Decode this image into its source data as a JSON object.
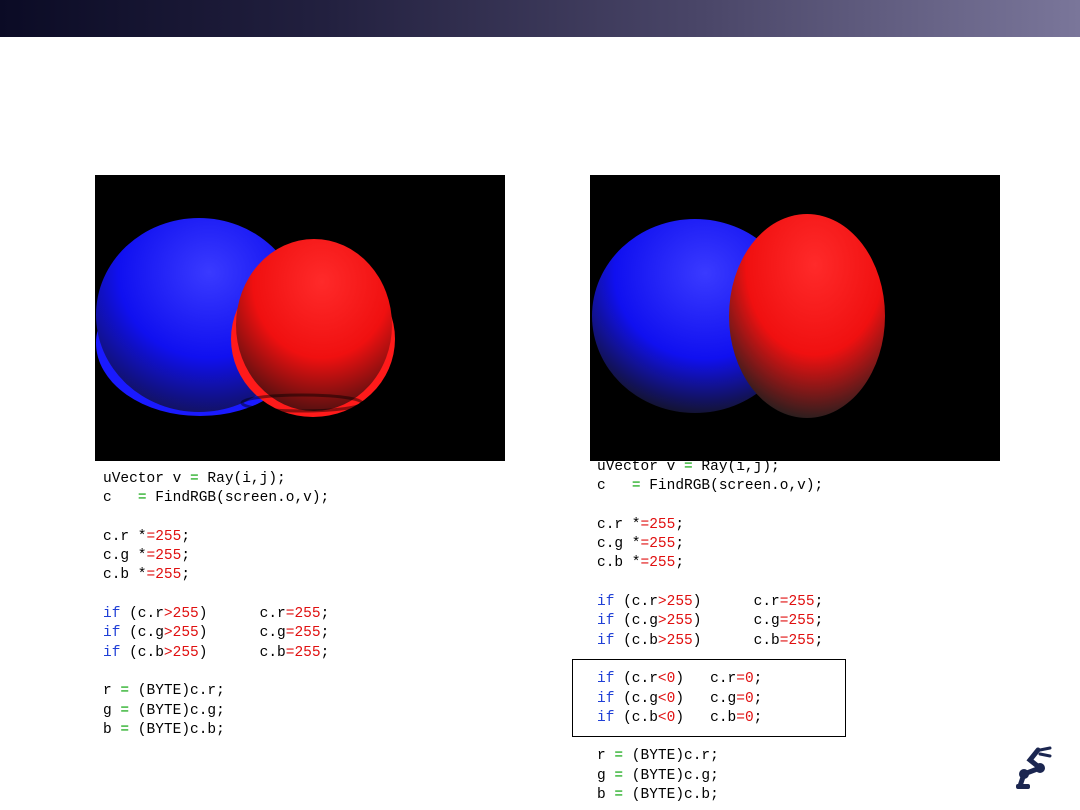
{
  "colors": {
    "keyword": "#1f3fd6",
    "number": "#e01010",
    "operator_assign": "#00a000",
    "sphere_blue": "#1c1cff",
    "sphere_red": "#ff1c1c"
  },
  "left_code": [
    [
      {
        "t": "uVector v "
      },
      {
        "t": "=",
        "c": "op-g"
      },
      {
        "t": " Ray(i,j);"
      }
    ],
    [
      {
        "t": "c   "
      },
      {
        "t": "=",
        "c": "op-g"
      },
      {
        "t": " FindRGB(screen.o,v);"
      }
    ],
    [],
    [
      {
        "t": "c.r *"
      },
      {
        "t": "=255",
        "c": "op-r"
      },
      {
        "t": ";"
      }
    ],
    [
      {
        "t": "c.g *"
      },
      {
        "t": "=255",
        "c": "op-r"
      },
      {
        "t": ";"
      }
    ],
    [
      {
        "t": "c.b *"
      },
      {
        "t": "=255",
        "c": "op-r"
      },
      {
        "t": ";"
      }
    ],
    [],
    [
      {
        "t": "if",
        "c": "kw"
      },
      {
        "t": " (c.r"
      },
      {
        "t": ">255",
        "c": "op-r"
      },
      {
        "t": ")      c.r"
      },
      {
        "t": "=255",
        "c": "op-r"
      },
      {
        "t": ";"
      }
    ],
    [
      {
        "t": "if",
        "c": "kw"
      },
      {
        "t": " (c.g"
      },
      {
        "t": ">255",
        "c": "op-r"
      },
      {
        "t": ")      c.g"
      },
      {
        "t": "=255",
        "c": "op-r"
      },
      {
        "t": ";"
      }
    ],
    [
      {
        "t": "if",
        "c": "kw"
      },
      {
        "t": " (c.b"
      },
      {
        "t": ">255",
        "c": "op-r"
      },
      {
        "t": ")      c.b"
      },
      {
        "t": "=255",
        "c": "op-r"
      },
      {
        "t": ";"
      }
    ],
    [],
    [
      {
        "t": "r "
      },
      {
        "t": "=",
        "c": "op-g"
      },
      {
        "t": " (BYTE)c.r;"
      }
    ],
    [
      {
        "t": "g "
      },
      {
        "t": "=",
        "c": "op-g"
      },
      {
        "t": " (BYTE)c.g;"
      }
    ],
    [
      {
        "t": "b "
      },
      {
        "t": "=",
        "c": "op-g"
      },
      {
        "t": " (BYTE)c.b;"
      }
    ]
  ],
  "right_code": [
    [
      {
        "t": "uVector v "
      },
      {
        "t": "=",
        "c": "op-g"
      },
      {
        "t": " Ray(i,j);"
      }
    ],
    [
      {
        "t": "c   "
      },
      {
        "t": "=",
        "c": "op-g"
      },
      {
        "t": " FindRGB(screen.o,v);"
      }
    ],
    [],
    [
      {
        "t": "c.r *"
      },
      {
        "t": "=255",
        "c": "op-r"
      },
      {
        "t": ";"
      }
    ],
    [
      {
        "t": "c.g *"
      },
      {
        "t": "=255",
        "c": "op-r"
      },
      {
        "t": ";"
      }
    ],
    [
      {
        "t": "c.b *"
      },
      {
        "t": "=255",
        "c": "op-r"
      },
      {
        "t": ";"
      }
    ],
    [],
    [
      {
        "t": "if",
        "c": "kw"
      },
      {
        "t": " (c.r"
      },
      {
        "t": ">255",
        "c": "op-r"
      },
      {
        "t": ")      c.r"
      },
      {
        "t": "=255",
        "c": "op-r"
      },
      {
        "t": ";"
      }
    ],
    [
      {
        "t": "if",
        "c": "kw"
      },
      {
        "t": " (c.g"
      },
      {
        "t": ">255",
        "c": "op-r"
      },
      {
        "t": ")      c.g"
      },
      {
        "t": "=255",
        "c": "op-r"
      },
      {
        "t": ";"
      }
    ],
    [
      {
        "t": "if",
        "c": "kw"
      },
      {
        "t": " (c.b"
      },
      {
        "t": ">255",
        "c": "op-r"
      },
      {
        "t": ")      c.b"
      },
      {
        "t": "=255",
        "c": "op-r"
      },
      {
        "t": ";"
      }
    ],
    [],
    [
      {
        "t": "if",
        "c": "kw"
      },
      {
        "t": " (c.r"
      },
      {
        "t": "<0",
        "c": "op-r"
      },
      {
        "t": ")   c.r"
      },
      {
        "t": "=0",
        "c": "op-r"
      },
      {
        "t": ";"
      }
    ],
    [
      {
        "t": "if",
        "c": "kw"
      },
      {
        "t": " (c.g"
      },
      {
        "t": "<0",
        "c": "op-r"
      },
      {
        "t": ")   c.g"
      },
      {
        "t": "=0",
        "c": "op-r"
      },
      {
        "t": ";"
      }
    ],
    [
      {
        "t": "if",
        "c": "kw"
      },
      {
        "t": " (c.b"
      },
      {
        "t": "<0",
        "c": "op-r"
      },
      {
        "t": ")   c.b"
      },
      {
        "t": "=0",
        "c": "op-r"
      },
      {
        "t": ";"
      }
    ],
    [],
    [
      {
        "t": "r "
      },
      {
        "t": "=",
        "c": "op-g"
      },
      {
        "t": " (BYTE)c.r;"
      }
    ],
    [
      {
        "t": "g "
      },
      {
        "t": "=",
        "c": "op-g"
      },
      {
        "t": " (BYTE)c.g;"
      }
    ],
    [
      {
        "t": "b "
      },
      {
        "t": "=",
        "c": "op-g"
      },
      {
        "t": " (BYTE)c.b;"
      }
    ]
  ],
  "logo": {
    "icon": "robot-arm-icon"
  }
}
